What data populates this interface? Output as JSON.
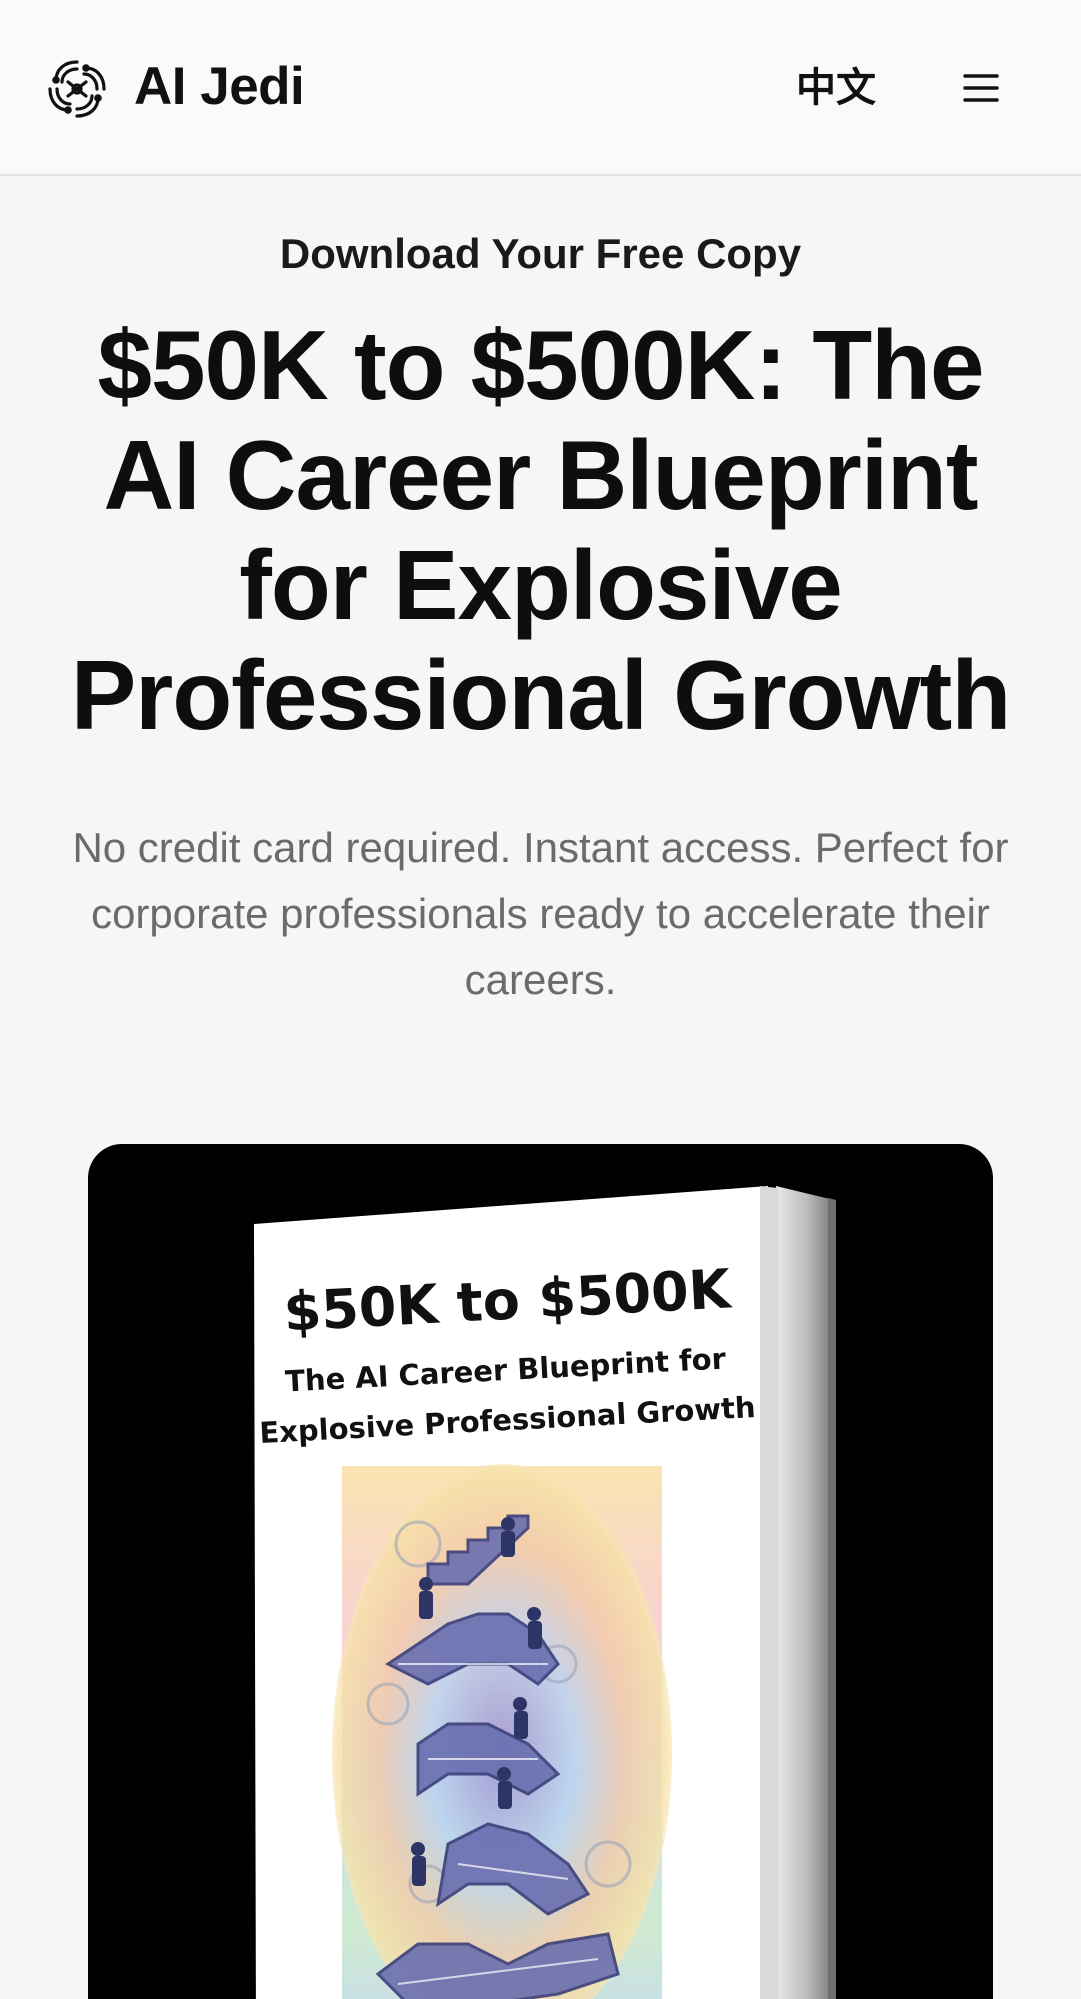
{
  "header": {
    "brand": "AI Jedi",
    "language_toggle": "中文",
    "logo_icon": "swirl-logo-icon",
    "menu_icon": "hamburger-menu-icon"
  },
  "hero": {
    "eyebrow": "Download Your Free Copy",
    "title": "$50K to $500K: The AI Career Blueprint for Explosive Professional Growth",
    "subtitle": "No credit card required. Instant access. Perfect for corporate professionals ready to accelerate their careers."
  },
  "book": {
    "cover_title": "$50K to $500K",
    "cover_subtitle_line1": "The AI Career Blueprint for",
    "cover_subtitle_line2": "Explosive Professional Growth"
  },
  "colors": {
    "background": "#f6f6f7",
    "text": "#111111",
    "muted": "#6b6b6b",
    "card": "#000000"
  }
}
